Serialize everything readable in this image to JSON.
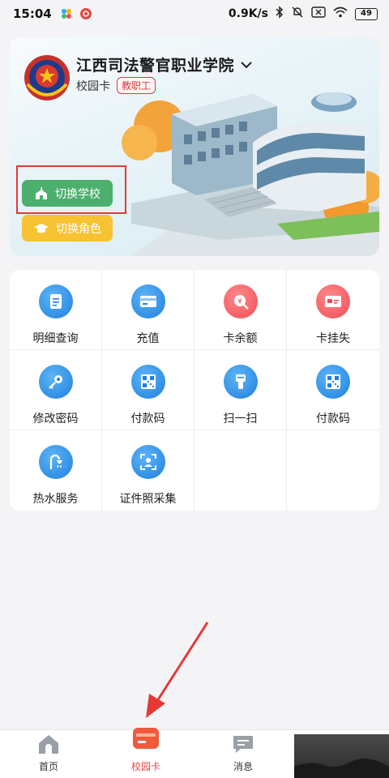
{
  "status_bar": {
    "time": "15:04",
    "network_speed": "0.9K/s",
    "battery": "49"
  },
  "hero": {
    "school_name": "江西司法警官职业学院",
    "card_type": "校园卡",
    "role_tag": "教职工",
    "switch_school_label": "切换学校",
    "switch_role_label": "切换角色"
  },
  "services": [
    {
      "label": "明细查询",
      "icon": "list-detail-icon",
      "color": "#1e7fe0"
    },
    {
      "label": "充值",
      "icon": "recharge-card-icon",
      "color": "#1e7fe0"
    },
    {
      "label": "卡余额",
      "icon": "balance-search-icon",
      "color": "#f04c55"
    },
    {
      "label": "卡挂失",
      "icon": "card-lost-icon",
      "color": "#f04c55"
    },
    {
      "label": "修改密码",
      "icon": "key-icon",
      "color": "#1e7fe0"
    },
    {
      "label": "付款码",
      "icon": "qr-code-icon",
      "color": "#1e7fe0"
    },
    {
      "label": "扫一扫",
      "icon": "scanner-icon",
      "color": "#1e7fe0"
    },
    {
      "label": "付款码",
      "icon": "qr-code-icon",
      "color": "#1e7fe0"
    },
    {
      "label": "热水服务",
      "icon": "shower-icon",
      "color": "#1e7fe0"
    },
    {
      "label": "证件照采集",
      "icon": "id-photo-icon",
      "color": "#1e7fe0"
    }
  ],
  "nav": {
    "home": "首页",
    "campus_card": "校园卡",
    "messages": "消息",
    "active": "校园卡"
  },
  "colors": {
    "accent_red": "#e8473f",
    "switch_school_green": "#4caf6e",
    "switch_role_yellow": "#f7c332"
  }
}
